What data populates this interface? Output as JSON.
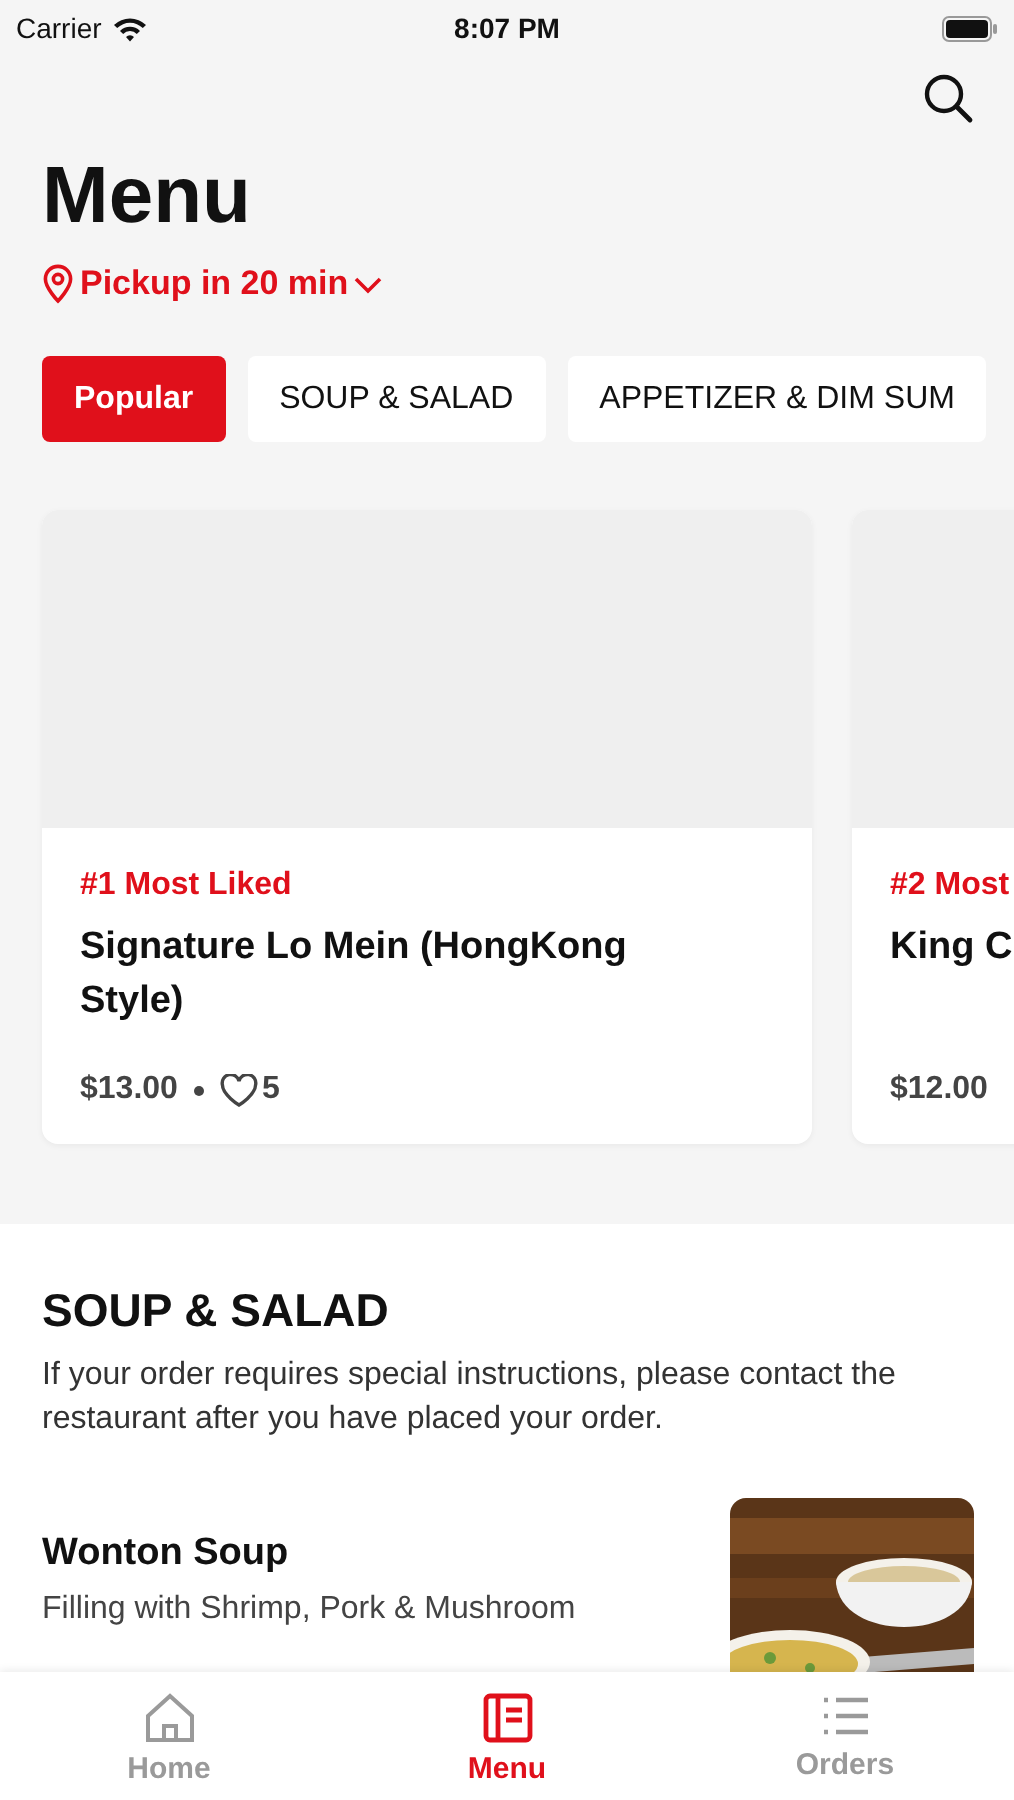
{
  "status_bar": {
    "carrier": "Carrier",
    "time": "8:07 PM"
  },
  "header": {
    "title": "Menu",
    "pickup": "Pickup in 20 min"
  },
  "categories": [
    {
      "label": "Popular",
      "selected": true
    },
    {
      "label": "SOUP & SALAD",
      "selected": false
    },
    {
      "label": "APPETIZER & DIM SUM",
      "selected": false
    }
  ],
  "featured": [
    {
      "rank": "#1 Most Liked",
      "name": "Signature Lo Mein (HongKong Style)",
      "price": "$13.00",
      "likes": "5"
    },
    {
      "rank": "#2 Most",
      "name": "King C",
      "price": "$12.00"
    }
  ],
  "section": {
    "title": "SOUP & SALAD",
    "note": "If your order requires special instructions, please contact the restaurant after you have placed your order.",
    "items": [
      {
        "name": "Wonton Soup",
        "description": "Filling with Shrimp, Pork & Mushroom"
      }
    ]
  },
  "tab_bar": [
    {
      "label": "Home",
      "kind": "home",
      "selected": false
    },
    {
      "label": "Menu",
      "kind": "menu",
      "selected": true
    },
    {
      "label": "Orders",
      "kind": "orders",
      "selected": false
    }
  ]
}
